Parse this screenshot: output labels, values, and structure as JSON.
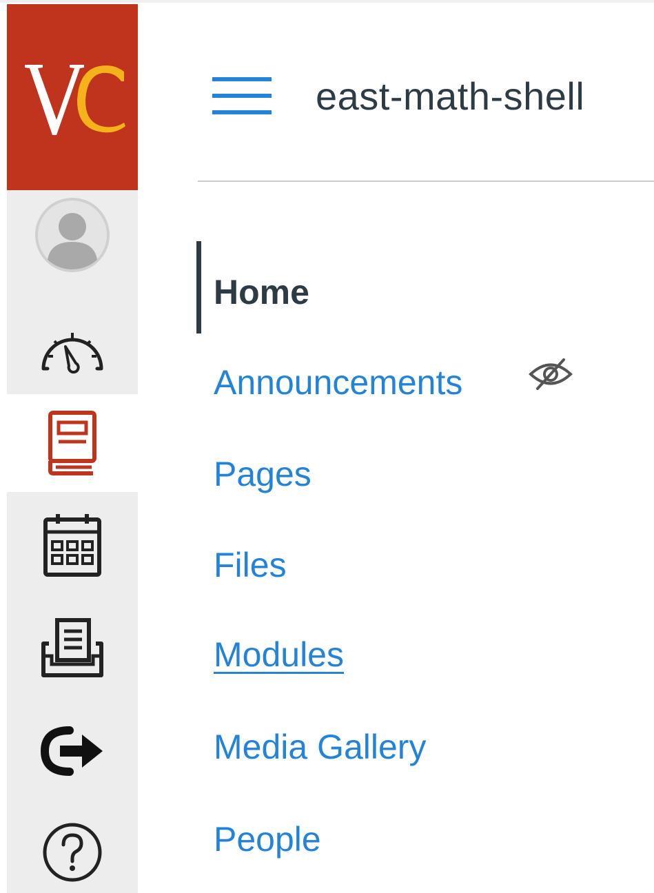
{
  "logo": {
    "letters": "VC",
    "colors": {
      "background": "#c0331d",
      "v": "#ffffff",
      "c": "#f5b21b"
    }
  },
  "global_nav": {
    "items": [
      {
        "id": "account",
        "icon": "user-avatar-icon"
      },
      {
        "id": "dashboard",
        "icon": "speedometer-icon"
      },
      {
        "id": "courses",
        "icon": "book-icon",
        "active": true
      },
      {
        "id": "calendar",
        "icon": "calendar-icon"
      },
      {
        "id": "inbox",
        "icon": "inbox-icon"
      },
      {
        "id": "history",
        "icon": "arrow-out-icon"
      },
      {
        "id": "help",
        "icon": "help-circle-icon"
      }
    ]
  },
  "course": {
    "title": "east-math-shell",
    "nav": [
      {
        "label": "Home",
        "active": true
      },
      {
        "label": "Announcements",
        "hidden_from_students": true,
        "icon": "eye-slash-icon"
      },
      {
        "label": "Pages"
      },
      {
        "label": "Files"
      },
      {
        "label": "Modules",
        "hovered": true
      },
      {
        "label": "Media Gallery"
      },
      {
        "label": "People"
      }
    ]
  },
  "colors": {
    "link": "#2283d8",
    "text": "#2d3b45",
    "nav_background": "#ededed",
    "courses_icon": "#c0331d"
  }
}
